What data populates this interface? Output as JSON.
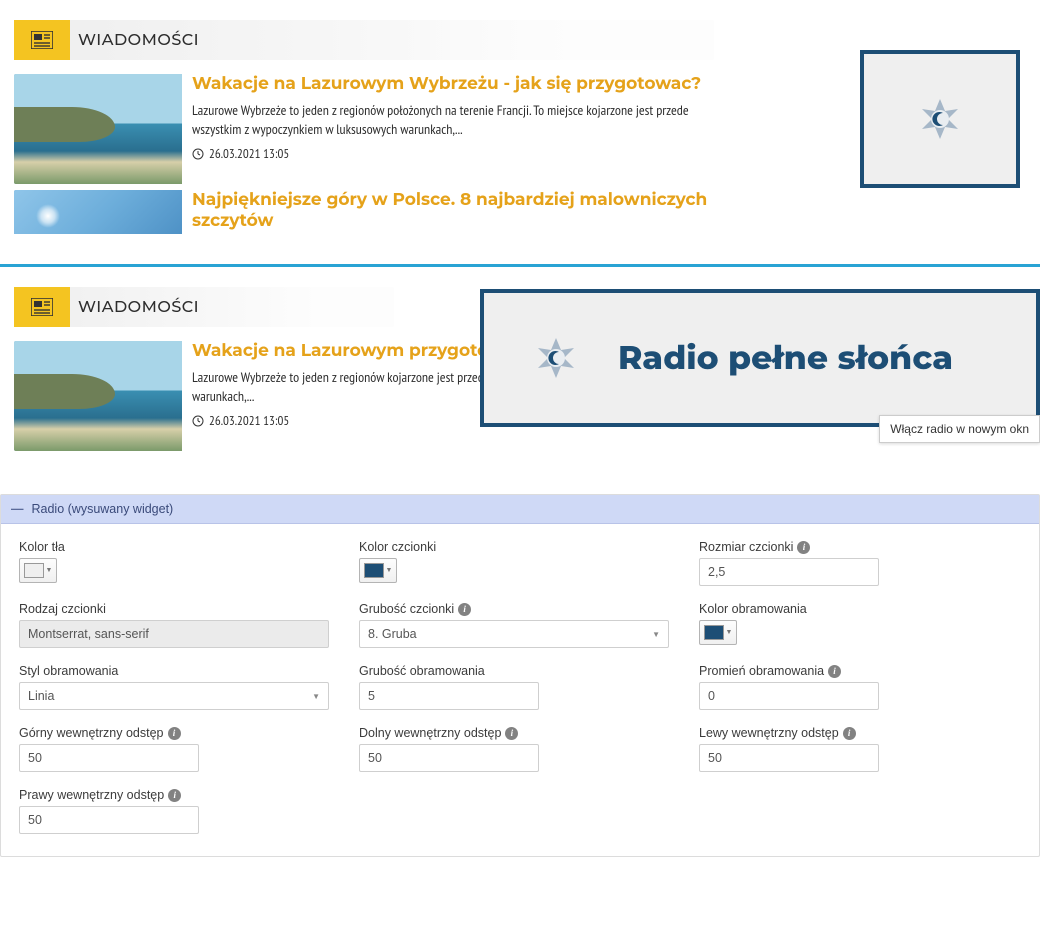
{
  "preview": {
    "section_title": "WIADOMOŚCI",
    "items": [
      {
        "headline": "Wakacje na Lazurowym Wybrzeżu - jak się przygotowac?",
        "excerpt": "Lazurowe Wybrzeże to jeden z regionów położonych na terenie Francji. To miejsce kojarzone jest przede wszystkim z wypoczynkiem w luksusowych warunkach,...",
        "date": "26.03.2021 13:05"
      },
      {
        "headline": "Najpiękniejsze góry w Polsce. 8 najbardziej malowniczych szczytów",
        "excerpt": "",
        "date": ""
      }
    ],
    "items2": [
      {
        "headline": "Wakacje na Lazurowym przygotowac?",
        "excerpt": "Lazurowe Wybrzeże to jeden z regionów\nkojarzone jest przede wszystkim z wypoczynkiem w luksusowych warunkach,...",
        "date": "26.03.2021 13:05"
      }
    ]
  },
  "widget": {
    "text": "Radio pełne słońca",
    "tooltip": "Włącz radio w nowym okn"
  },
  "settings": {
    "panel_title": "Radio (wysuwany widget)",
    "bg_color_label": "Kolor tła",
    "bg_color_value": "#efefef",
    "font_color_label": "Kolor czcionki",
    "font_color_value": "#1d4e75",
    "font_size_label": "Rozmiar czcionki",
    "font_size_value": "2,5",
    "font_family_label": "Rodzaj czcionki",
    "font_family_value": "Montserrat, sans-serif",
    "font_weight_label": "Grubość czcionki",
    "font_weight_value": "8. Gruba",
    "border_color_label": "Kolor obramowania",
    "border_color_value": "#1d4e75",
    "border_style_label": "Styl obramowania",
    "border_style_value": "Linia",
    "border_width_label": "Grubość obramowania",
    "border_width_value": "5",
    "border_radius_label": "Promień obramowania",
    "border_radius_value": "0",
    "pad_top_label": "Górny wewnętrzny odstęp",
    "pad_top_value": "50",
    "pad_bottom_label": "Dolny wewnętrzny odstęp",
    "pad_bottom_value": "50",
    "pad_left_label": "Lewy wewnętrzny odstęp",
    "pad_left_value": "50",
    "pad_right_label": "Prawy wewnętrzny odstęp",
    "pad_right_value": "50"
  },
  "icons": {
    "newspaper": "newspaper-icon",
    "clock": "clock-icon",
    "info": "i"
  }
}
